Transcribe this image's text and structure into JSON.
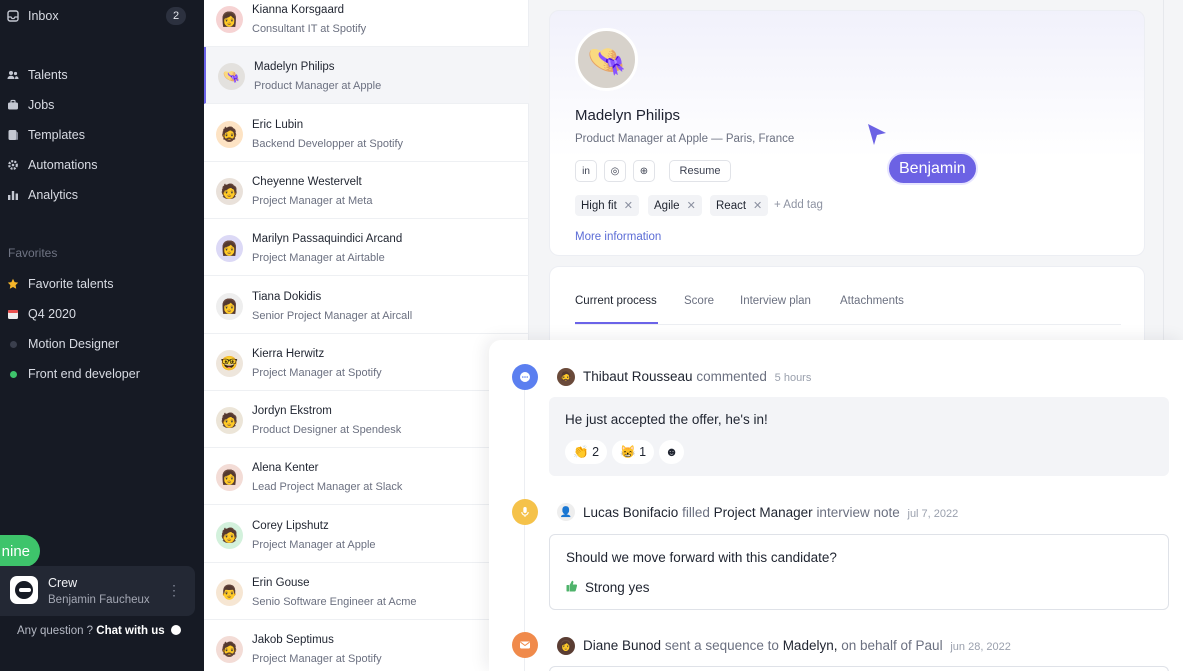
{
  "sidebar": {
    "inbox": {
      "label": "Inbox",
      "badge": "2"
    },
    "nav": [
      {
        "label": "Talents",
        "icon": "users-icon"
      },
      {
        "label": "Jobs",
        "icon": "briefcase-icon"
      },
      {
        "label": "Templates",
        "icon": "document-icon"
      },
      {
        "label": "Automations",
        "icon": "gear-icon"
      },
      {
        "label": "Analytics",
        "icon": "bar-chart-icon"
      }
    ],
    "favorites_heading": "Favorites",
    "favorites": [
      {
        "label": "Favorite talents",
        "icon": "star-icon",
        "color": "#f5b529"
      },
      {
        "label": "Q4 2020",
        "icon": "calendar-icon",
        "color": "#e8504e"
      },
      {
        "label": "Motion Designer",
        "icon": "dot-icon",
        "color": "#3a3f4d"
      },
      {
        "label": "Front end developer",
        "icon": "dot-icon",
        "color": "#3ec46b"
      }
    ],
    "online_pill": "nine",
    "workspace": {
      "name": "Crew",
      "user": "Benjamin Faucheux"
    },
    "help": {
      "question": "Any question ?",
      "link": "Chat with us"
    }
  },
  "candidates": [
    {
      "name": "Kianna Korsgaard",
      "role": "Consultant IT at Spotify",
      "bg": "#f6d3d3",
      "emoji": "👩"
    },
    {
      "name": "Madelyn Philips",
      "role": "Product Manager at Apple",
      "bg": "#e3e1de",
      "emoji": "👒",
      "selected": true
    },
    {
      "name": "Eric Lubin",
      "role": "Backend Developper at Spotify",
      "bg": "#fde3c4",
      "emoji": "🧔"
    },
    {
      "name": "Cheyenne Westervelt",
      "role": "Project Manager at Meta",
      "bg": "#e9e1da",
      "emoji": "🧑"
    },
    {
      "name": "Marilyn Passaquindici Arcand",
      "role": "Project Manager at Airtable",
      "bg": "#dcd9f6",
      "emoji": "👩"
    },
    {
      "name": "Tiana Dokidis",
      "role": "Senior Project Manager at Aircall",
      "bg": "#eeeeee",
      "emoji": "👩"
    },
    {
      "name": "Kierra Herwitz",
      "role": "Project Manager at Spotify",
      "bg": "#eee6dc",
      "emoji": "🤓"
    },
    {
      "name": "Jordyn Ekstrom",
      "role": "Product Designer at Spendesk",
      "bg": "#ece5d8",
      "emoji": "🧑"
    },
    {
      "name": "Alena Kenter",
      "role": "Lead Project Manager at Slack",
      "bg": "#f3dcd6",
      "emoji": "👩"
    },
    {
      "name": "Corey Lipshutz",
      "role": "Project Manager at Apple",
      "bg": "#d3f1dc",
      "emoji": "🧑"
    },
    {
      "name": "Erin Gouse",
      "role": "Senio Software Engineer at Acme",
      "bg": "#f6e6d3",
      "emoji": "👨"
    },
    {
      "name": "Jakob Septimus",
      "role": "Project Manager at Spotify",
      "bg": "#f3dcd6",
      "emoji": "🧔"
    }
  ],
  "profile": {
    "name": "Madelyn Philips",
    "subtitle": "Product Manager at Apple — Paris, France",
    "links": [
      {
        "label": "in",
        "icon": "linkedin-icon"
      },
      {
        "label": "◎",
        "icon": "dribbble-icon"
      },
      {
        "label": "⊕",
        "icon": "globe-icon"
      }
    ],
    "resume": "Resume",
    "tags": [
      "High fit",
      "Agile",
      "React"
    ],
    "add_tag": "+ Add tag",
    "more_info": "More information"
  },
  "cursor": {
    "label": "Benjamin",
    "color": "#6c62e4"
  },
  "tabs": [
    "Current process",
    "Score",
    "Interview plan",
    "Attachments"
  ],
  "activity": {
    "comment": {
      "author": "Thibaut Rousseau",
      "action": "commented",
      "time": "5 hours",
      "text": "He just accepted the offer, he's in!",
      "reactions": [
        {
          "emoji": "👏",
          "count": "2"
        },
        {
          "emoji": "😸",
          "count": "1"
        },
        {
          "emoji": "☻",
          "count": ""
        }
      ]
    },
    "note": {
      "author": "Lucas Bonifacio",
      "action": "filled",
      "target": "Project Manager",
      "suffix": "interview note",
      "time": "jul 7, 2022",
      "question": "Should we move forward with this candidate?",
      "answer": "Strong yes"
    },
    "sequence": {
      "author": "Diane Bunod",
      "action": "sent a sequence to",
      "target": "Madelyn,",
      "suffix": "on behalf of Paul",
      "time": "jun 28, 2022"
    }
  }
}
